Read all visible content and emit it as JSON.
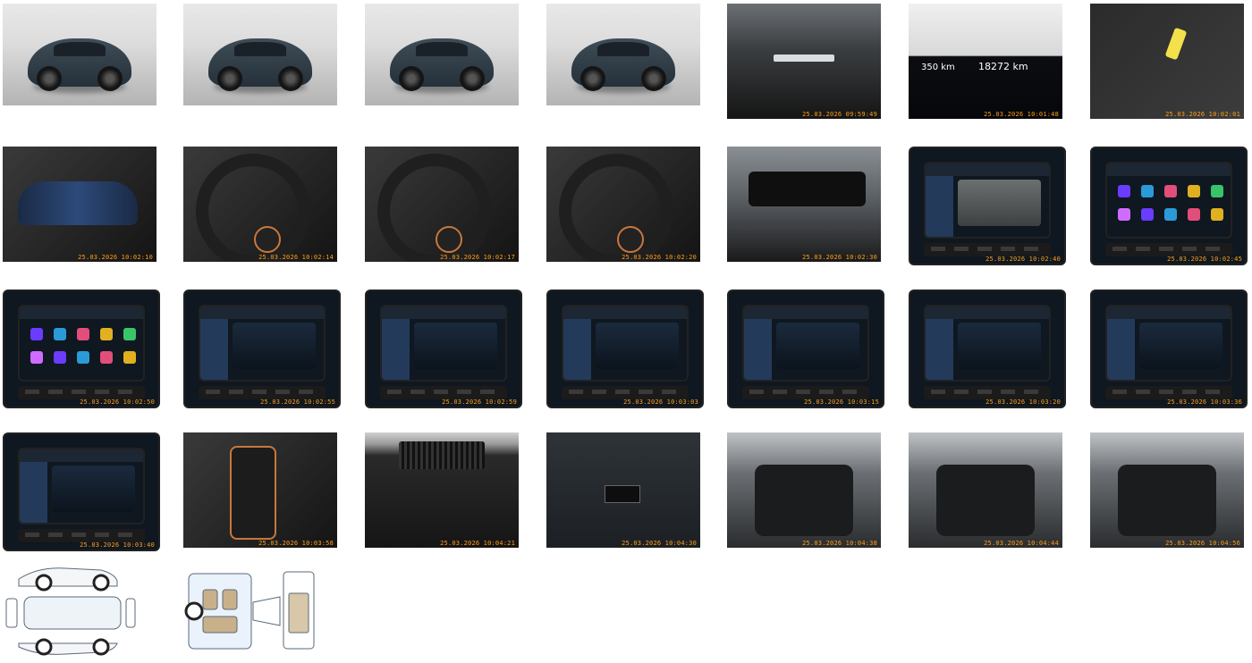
{
  "gallery": {
    "photos": [
      {
        "name": "exterior-front-left",
        "kind": "studio",
        "timestamp": ""
      },
      {
        "name": "exterior-rear-left",
        "kind": "studio",
        "timestamp": ""
      },
      {
        "name": "exterior-rear",
        "kind": "studio",
        "timestamp": ""
      },
      {
        "name": "exterior-front-right",
        "kind": "studio",
        "timestamp": ""
      },
      {
        "name": "windshield-vin",
        "kind": "dark",
        "timestamp": "25.03.2026 09:59:49"
      },
      {
        "name": "odometer",
        "kind": "dark",
        "timestamp": "25.03.2026 10:01:48",
        "readouts": [
          "350 km",
          "18272 km"
        ]
      },
      {
        "name": "keys",
        "kind": "dark",
        "timestamp": "25.03.2026 10:02:01"
      },
      {
        "name": "instrument-cluster",
        "kind": "dark",
        "timestamp": "25.03.2026 10:02:10"
      },
      {
        "name": "steering-wheel-left",
        "kind": "dark",
        "timestamp": "25.03.2026 10:02:14"
      },
      {
        "name": "steering-wheel-right",
        "kind": "dark",
        "timestamp": "25.03.2026 10:02:17"
      },
      {
        "name": "dashboard",
        "kind": "dark",
        "timestamp": "25.03.2026 10:02:20"
      },
      {
        "name": "rear-view-mirror",
        "kind": "dark",
        "timestamp": "25.03.2026 10:02:30"
      },
      {
        "name": "rear-camera-screen",
        "kind": "screen",
        "timestamp": "25.03.2026 10:02:40"
      },
      {
        "name": "apps-screen-1",
        "kind": "screen",
        "timestamp": "25.03.2026 10:02:45"
      },
      {
        "name": "apps-screen-2",
        "kind": "screen",
        "timestamp": "25.03.2026 10:02:50"
      },
      {
        "name": "media-screen",
        "kind": "screen",
        "timestamp": "25.03.2026 10:02:55"
      },
      {
        "name": "full-link-screen",
        "kind": "screen",
        "timestamp": "25.03.2026 10:02:59"
      },
      {
        "name": "full-link-settings",
        "kind": "screen",
        "timestamp": "25.03.2026 10:03:03"
      },
      {
        "name": "smart-systems-screen",
        "kind": "screen",
        "timestamp": "25.03.2026 10:03:15"
      },
      {
        "name": "driver-assist-screen",
        "kind": "screen",
        "timestamp": "25.03.2026 10:03:20"
      },
      {
        "name": "service-screen",
        "kind": "screen",
        "timestamp": "25.03.2026 10:03:36"
      },
      {
        "name": "ambient-light-screen",
        "kind": "screen",
        "timestamp": "25.03.2026 10:03:40"
      },
      {
        "name": "gear-selector",
        "kind": "dark",
        "timestamp": "25.03.2026 10:03:58"
      },
      {
        "name": "rear-vents",
        "kind": "dark",
        "timestamp": "25.03.2026 10:04:21"
      },
      {
        "name": "door-panel",
        "kind": "dark",
        "timestamp": "25.03.2026 10:04:30"
      },
      {
        "name": "trunk",
        "kind": "dark",
        "timestamp": "25.03.2026 10:04:38"
      },
      {
        "name": "rear-seats",
        "kind": "dark",
        "timestamp": "25.03.2026 10:04:44"
      },
      {
        "name": "front-interior",
        "kind": "dark",
        "timestamp": "25.03.2026 10:04:56"
      },
      {
        "name": "exterior-damage-diagram",
        "kind": "diagram",
        "timestamp": ""
      },
      {
        "name": "interior-damage-diagram",
        "kind": "diagram",
        "timestamp": ""
      }
    ]
  },
  "colors": {
    "timestamp": "#ff9f1a",
    "body_paint": "#2f3c46",
    "accent_copper": "#c7773e",
    "diagram_line": "#5a6a7a"
  }
}
